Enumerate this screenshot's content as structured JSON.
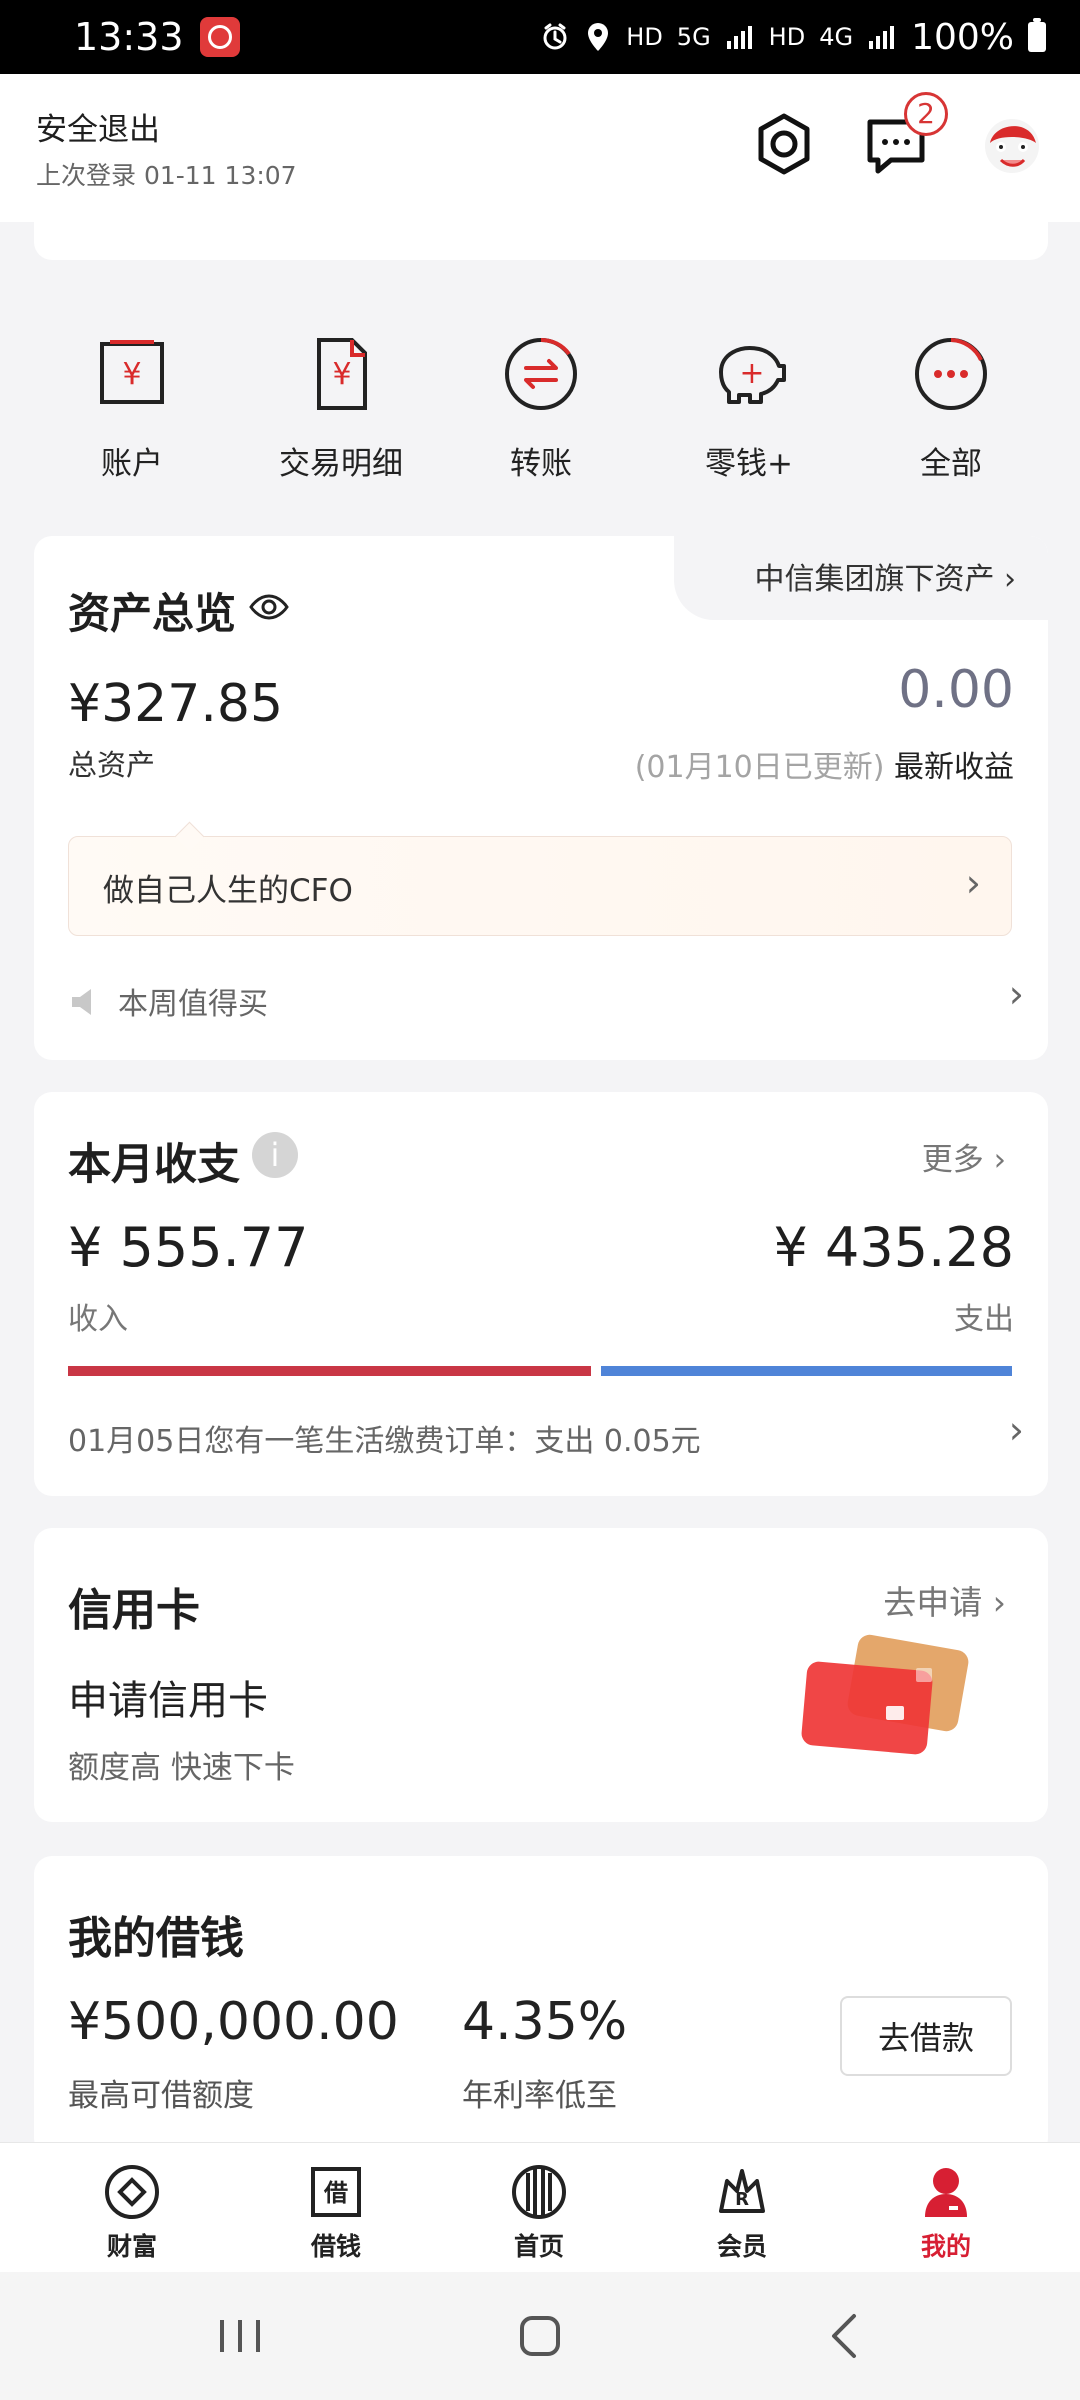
{
  "status_bar": {
    "time": "13:33",
    "network_hd1": "HD",
    "network_5g": "5G",
    "network_hd2": "HD",
    "network_4g": "4G",
    "battery": "100%"
  },
  "header": {
    "logout": "安全退出",
    "last_login": "上次登录 01-11 13:07",
    "message_count": "2"
  },
  "quick_actions": [
    {
      "label": "账户",
      "icon": "account-icon"
    },
    {
      "label": "交易明细",
      "icon": "transaction-detail-icon"
    },
    {
      "label": "转账",
      "icon": "transfer-icon"
    },
    {
      "label": "零钱+",
      "icon": "piggy-bank-icon"
    },
    {
      "label": "全部",
      "icon": "more-icon"
    }
  ],
  "assets": {
    "title": "资产总览",
    "group_link": "中信集团旗下资产",
    "total_amount": "¥327.85",
    "total_label": "总资产",
    "profit_value": "0.00",
    "profit_date": "(01月10日已更新)",
    "profit_label": "最新收益",
    "cfo_text": "做自己人生的CFO",
    "weekly_text": "本周值得买"
  },
  "monthly": {
    "title": "本月收支",
    "more": "更多",
    "income": "¥ 555.77",
    "expense": "¥ 435.28",
    "income_label": "收入",
    "expense_label": "支出",
    "income_fraction": 0.56,
    "expense_fraction": 0.44,
    "note": "01月05日您有一笔生活缴费订单：支出 0.05元"
  },
  "credit": {
    "title": "信用卡",
    "apply": "去申请",
    "headline": "申请信用卡",
    "description": "额度高 快速下卡"
  },
  "loan": {
    "title": "我的借钱",
    "amount": "¥500,000.00",
    "amount_label": "最高可借额度",
    "rate": "4.35%",
    "rate_label": "年利率低至",
    "button": "去借款"
  },
  "bottom_nav": [
    {
      "label": "财富",
      "icon": "wealth-icon",
      "active": false
    },
    {
      "label": "借钱",
      "icon": "borrow-icon",
      "active": false
    },
    {
      "label": "首页",
      "icon": "home-icon",
      "active": false
    },
    {
      "label": "会员",
      "icon": "member-icon",
      "active": false
    },
    {
      "label": "我的",
      "icon": "profile-icon",
      "active": true
    }
  ],
  "icon_text": {
    "quick_yen": "¥",
    "quick_plus": "+",
    "borrow_char": "借",
    "member_char": "R",
    "info_char": "i"
  },
  "colors": {
    "brand_red": "#d71f33",
    "expense_blue": "#4f84d8",
    "page_background": "#f4f4f6"
  }
}
